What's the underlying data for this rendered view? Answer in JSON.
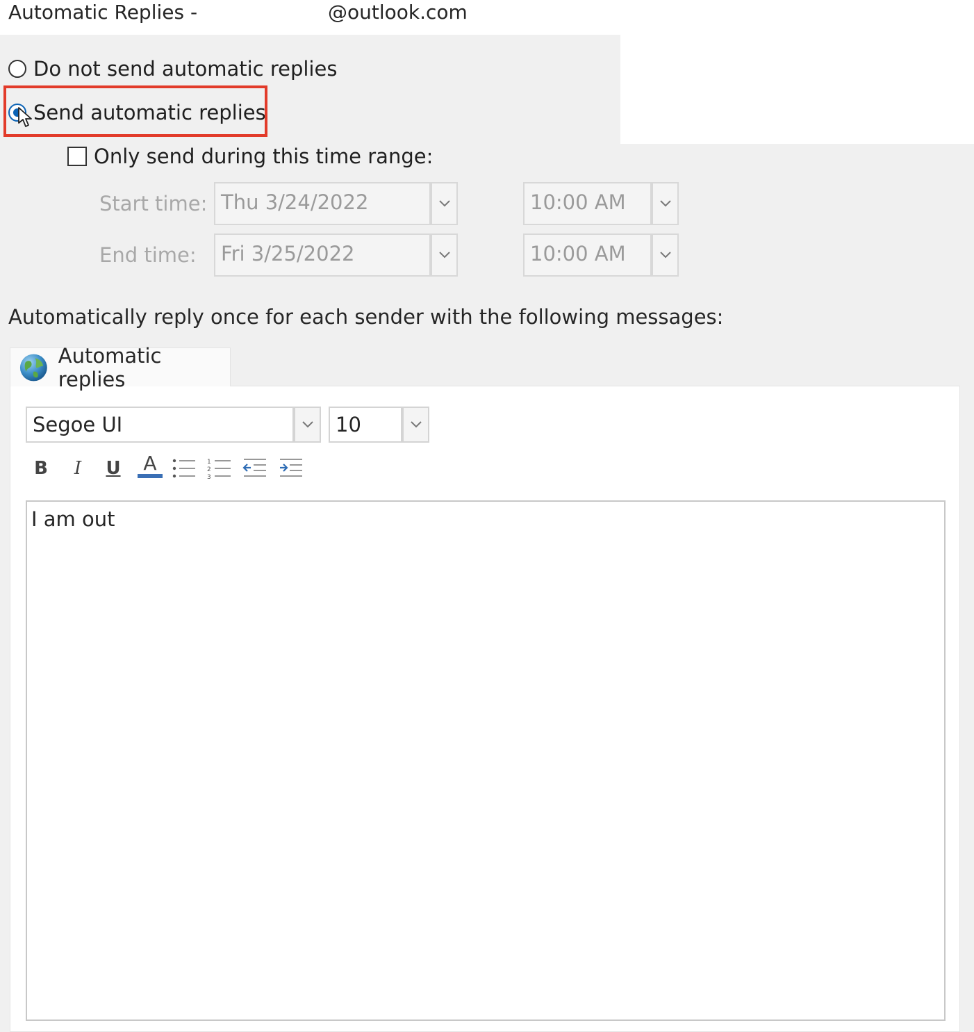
{
  "window": {
    "title": "Automatic Replies -",
    "account": "@outlook.com"
  },
  "options": {
    "no_replies_label": "Do not send automatic replies",
    "send_replies_label": "Send automatic replies",
    "selected": "send"
  },
  "time_range": {
    "checkbox_label": "Only send during this time range:",
    "checked": false,
    "start_label": "Start time:",
    "start_date": "Thu 3/24/2022",
    "start_time": "10:00 AM",
    "end_label": "End time:",
    "end_date": "Fri 3/25/2022",
    "end_time": "10:00 AM"
  },
  "instruction": "Automatically reply once for each sender with the following messages:",
  "tab": {
    "label": "Automatic replies",
    "icon": "globe-icon"
  },
  "formatting": {
    "font_name": "Segoe UI",
    "font_size": "10",
    "bold": "B",
    "italic": "I",
    "underline": "U",
    "font_color": "A",
    "font_color_value": "#3a6fb5"
  },
  "message": {
    "text": "I am out"
  },
  "colors": {
    "highlight": "#e23b2a",
    "radio_selected": "#0b63b5"
  }
}
